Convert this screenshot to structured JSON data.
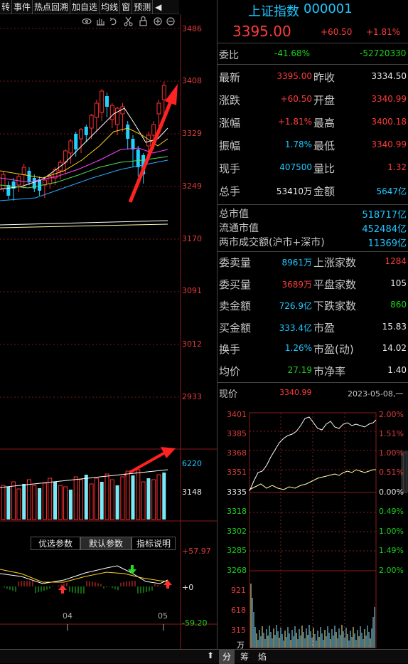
{
  "toolbar": {
    "items": [
      "转",
      "事件",
      "热点回溯",
      "加自选",
      "均线",
      "窗",
      "预测"
    ]
  },
  "kline": {
    "y_labels": [
      "3486",
      "3408",
      "3329",
      "3249",
      "3170",
      "3091",
      "3012",
      "2933"
    ],
    "vol_labels": [
      "6220",
      "3148"
    ]
  },
  "indicator": {
    "buttons": [
      "优选参数",
      "默认参数",
      "指标说明"
    ],
    "labels": [
      "+57.97",
      "+0",
      "-59.20"
    ],
    "x_labels": [
      "04",
      "05"
    ]
  },
  "quote": {
    "name": "上证指数",
    "code": "000001",
    "price": "3395.00",
    "change": "+60.50",
    "change_pct": "+1.81%"
  },
  "wei": {
    "label": "委比",
    "pct": "-41.68%",
    "diff": "-52720330"
  },
  "stats": [
    {
      "l": "最新",
      "v": "3395.00",
      "l2": "昨收",
      "v2": "3334.50"
    },
    {
      "l": "涨跌",
      "v": "+60.50",
      "l2": "开盘",
      "v2": "3340.99"
    },
    {
      "l": "涨幅",
      "v": "+1.81%",
      "l2": "最高",
      "v2": "3400.18"
    },
    {
      "l": "振幅",
      "v": "1.78%",
      "l2": "最低",
      "v2": "3340.99"
    },
    {
      "l": "现手",
      "v": "407500",
      "l2": "量比",
      "v2": "1.32"
    },
    {
      "l": "总手",
      "v": "53410万",
      "l2": "金额",
      "v2": "5647亿"
    }
  ],
  "market": [
    {
      "l": "总市值",
      "v": "518717亿"
    },
    {
      "l": "流通市值",
      "v": "452484亿"
    },
    {
      "l": "两市成交额(沪市+深市)",
      "v": "11369亿"
    }
  ],
  "orders": [
    {
      "l": "委卖量",
      "v": "8961万",
      "l2": "上涨家数",
      "v2": "1284"
    },
    {
      "l": "委买量",
      "v": "3689万",
      "l2": "平盘家数",
      "v2": "105"
    },
    {
      "l": "卖金额",
      "v": "726.9亿",
      "l2": "下跌家数",
      "v2": "860"
    },
    {
      "l": "买金额",
      "v": "333.4亿",
      "l2": "市盈",
      "v2": "15.83"
    },
    {
      "l": "换手",
      "v": "1.26%",
      "l2": "市盈(动)",
      "v2": "14.02"
    },
    {
      "l": "均价",
      "v": "27.19",
      "l2": "市净率",
      "v2": "1.40"
    }
  ],
  "current": {
    "label": "现价",
    "value": "3340.99",
    "date": "2023-05-08,一"
  },
  "intraday": {
    "left_labels": [
      "3401",
      "3385",
      "3368",
      "3351",
      "3335",
      "3318",
      "3302",
      "3285",
      "3268"
    ],
    "right_labels": [
      "2.00%",
      "1.51%",
      "1.00%",
      "0.51%",
      "0.00%",
      "0.49%",
      "1.00%",
      "1.49%",
      "2.00%"
    ],
    "vol_labels": [
      "921",
      "618",
      "315",
      "万"
    ]
  },
  "bottom": {
    "tabs": [
      "分",
      "筹",
      "焰"
    ]
  }
}
